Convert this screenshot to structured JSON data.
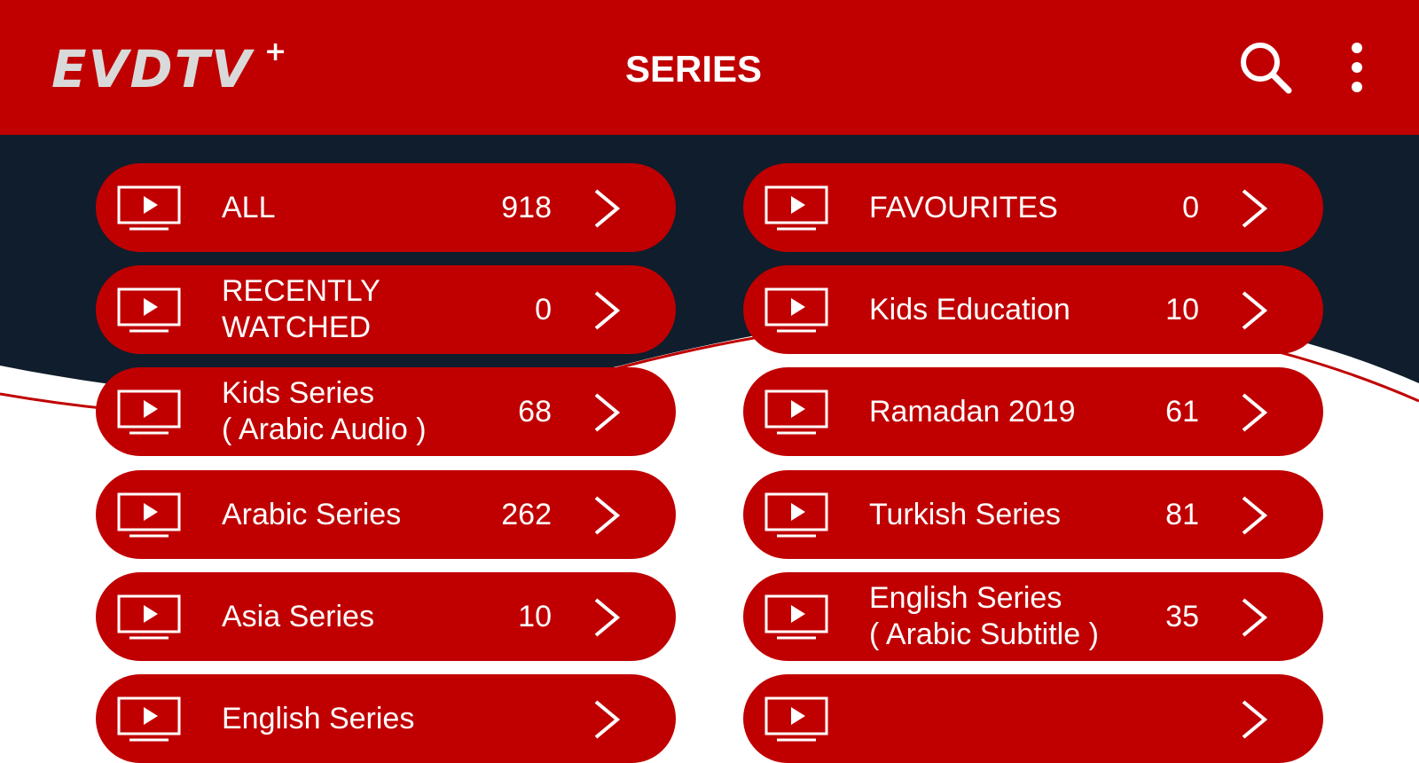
{
  "app": {
    "logo_text": "EVDTV",
    "logo_plus": "+",
    "title": "SERIES",
    "search_icon": "search-icon",
    "more_icon": "more-vertical-icon"
  },
  "colors": {
    "primary": "#c00000",
    "dark_band": "#0f1d2c",
    "text": "#ffffff"
  },
  "categories": [
    {
      "label": "ALL",
      "count": "918"
    },
    {
      "label": "FAVOURITES",
      "count": "0"
    },
    {
      "label": "RECENTLY\nWATCHED",
      "count": "0"
    },
    {
      "label": "Kids Education",
      "count": "10"
    },
    {
      "label": "Kids Series\n( Arabic Audio )",
      "count": "68"
    },
    {
      "label": "Ramadan 2019",
      "count": "61"
    },
    {
      "label": "Arabic Series",
      "count": "262"
    },
    {
      "label": "Turkish Series",
      "count": "81"
    },
    {
      "label": "Asia Series",
      "count": "10"
    },
    {
      "label": "English Series\n( Arabic Subtitle )",
      "count": "35"
    },
    {
      "label": "English Series",
      "count": ""
    },
    {
      "label": "",
      "count": ""
    }
  ]
}
